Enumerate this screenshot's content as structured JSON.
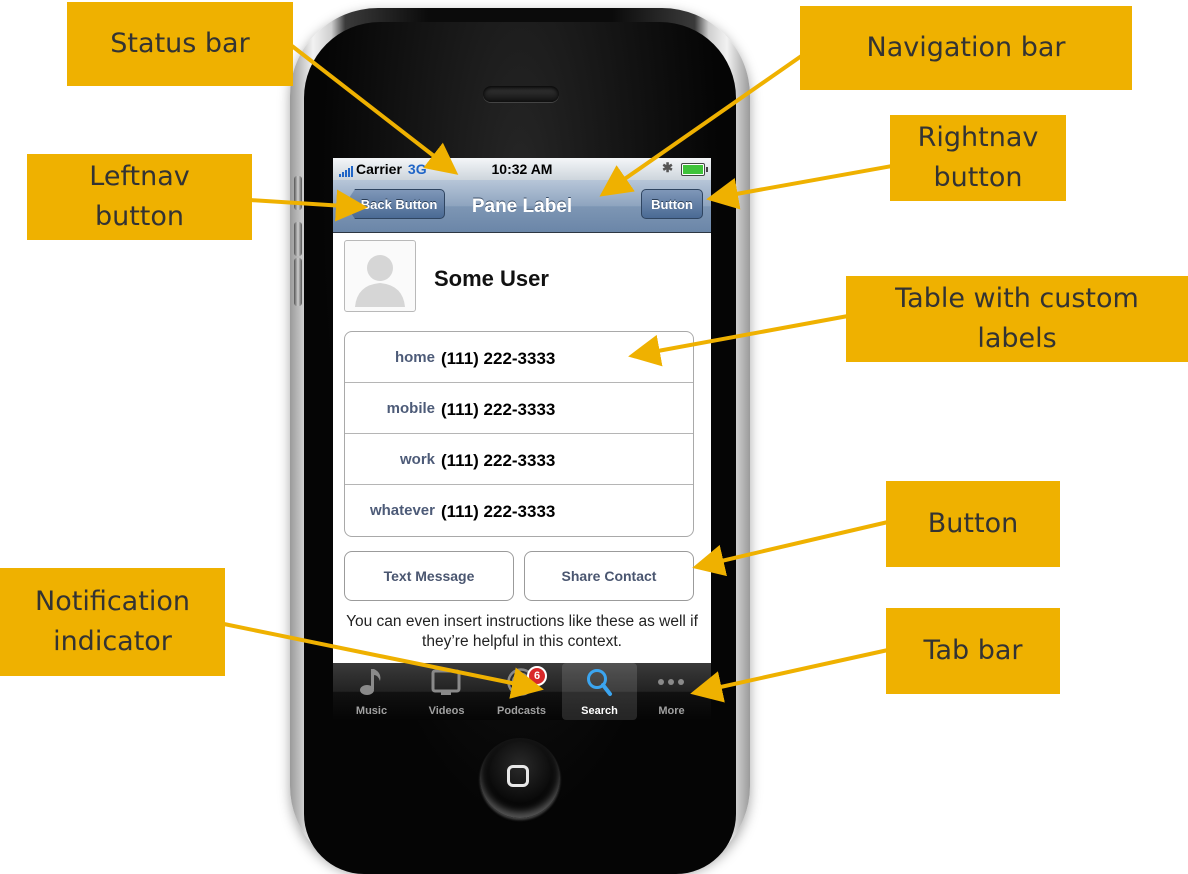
{
  "callouts": {
    "status_bar": "Status bar",
    "navigation_bar": "Navigation bar",
    "leftnav_button": "Leftnav button",
    "rightnav_button": "Rightnav button",
    "table_custom_labels": "Table with custom labels",
    "button": "Button",
    "notification_indicator": "Notification indicator",
    "tab_bar": "Tab bar"
  },
  "status_bar": {
    "carrier": "Carrier",
    "network": "3G",
    "time": "10:32 AM",
    "bluetooth_icon": "bluetooth-icon",
    "battery_icon": "battery-icon"
  },
  "nav": {
    "back_label": "Back Button",
    "title": "Pane Label",
    "right_label": "Button"
  },
  "contact": {
    "name": "Some User",
    "phones": [
      {
        "label": "home",
        "value": "(111) 222-3333"
      },
      {
        "label": "mobile",
        "value": "(111) 222-3333"
      },
      {
        "label": "work",
        "value": "(111) 222-3333"
      },
      {
        "label": "whatever",
        "value": "(111) 222-3333"
      }
    ]
  },
  "actions": {
    "text_message": "Text Message",
    "share_contact": "Share Contact"
  },
  "instructions": "You can even insert instructions like these as well if they’re helpful in this context.",
  "tabs": [
    {
      "label": "Music",
      "icon": "music-note-icon"
    },
    {
      "label": "Videos",
      "icon": "tv-icon"
    },
    {
      "label": "Podcasts",
      "icon": "podcast-icon",
      "badge": "6"
    },
    {
      "label": "Search",
      "icon": "magnifier-icon",
      "selected": true
    },
    {
      "label": "More",
      "icon": "ellipsis-icon"
    }
  ],
  "colors": {
    "callout": "#efb100",
    "arrow": "#efb100",
    "badge": "#d9282a",
    "nav_bar": "#7d96b4",
    "label_text": "#4d5b78"
  }
}
